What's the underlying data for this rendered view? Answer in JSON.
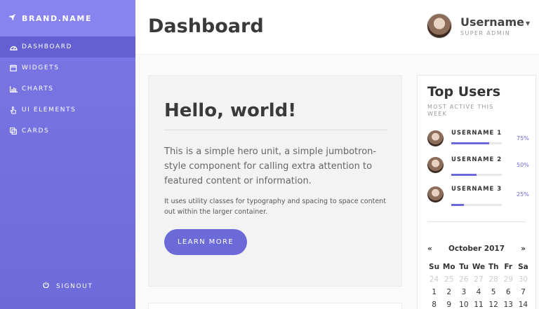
{
  "brand": {
    "name": "BRAND.NAME",
    "icon": "rocket-icon"
  },
  "sidebar": {
    "items": [
      {
        "label": "DASHBOARD",
        "icon": "dashboard-icon",
        "active": true
      },
      {
        "label": "WIDGETS",
        "icon": "calendar-icon",
        "active": false
      },
      {
        "label": "CHARTS",
        "icon": "bar-chart-icon",
        "active": false
      },
      {
        "label": "UI ELEMENTS",
        "icon": "hand-pointer-icon",
        "active": false
      },
      {
        "label": "CARDS",
        "icon": "clone-icon",
        "active": false
      }
    ],
    "signout": "SIGNOUT"
  },
  "header": {
    "title": "Dashboard",
    "user": {
      "name": "Username",
      "role": "SUPER ADMIN"
    }
  },
  "hero": {
    "title": "Hello, world!",
    "lead": "This is a simple hero unit, a simple jumbotron-style component for calling extra attention to featured content or information.",
    "small": "It uses utility classes for typography and spacing to space content out within the larger container.",
    "button": "LEARN MORE"
  },
  "top_users": {
    "title": "Top Users",
    "subtitle": "MOST ACTIVE THIS WEEK",
    "users": [
      {
        "name": "USERNAME 1",
        "percent": "75%",
        "progress": 0.75
      },
      {
        "name": "USERNAME 2",
        "percent": "50%",
        "progress": 0.5
      },
      {
        "name": "USERNAME 3",
        "percent": "25%",
        "progress": 0.25
      }
    ]
  },
  "calendar": {
    "prev": "«",
    "next": "»",
    "month": "October 2017",
    "days_of_week": [
      "Su",
      "Mo",
      "Tu",
      "We",
      "Th",
      "Fr",
      "Sa"
    ],
    "muted_days": [
      "24",
      "25",
      "26",
      "27",
      "28",
      "29",
      "30"
    ],
    "week1": [
      "1",
      "2",
      "3",
      "4",
      "5",
      "6",
      "7"
    ],
    "week2": [
      "8",
      "9",
      "10",
      "11",
      "12",
      "13",
      "14"
    ]
  },
  "colors": {
    "accent": "#6c69d9",
    "sidebar": "#7b78e6"
  }
}
